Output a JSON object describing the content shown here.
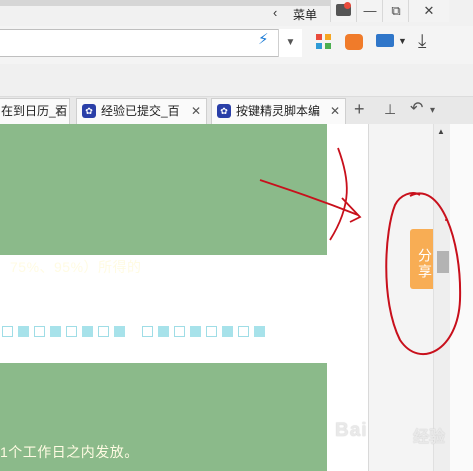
{
  "titlebar": {
    "back_glyph": "‹",
    "menu_label": "菜单",
    "minimize_glyph": "—",
    "restore_glyph": "⧉",
    "close_glyph": "✕"
  },
  "toolbar": {
    "address_value": "",
    "bolt_glyph": "⚡",
    "address_dropdown_glyph": "▼",
    "remote_dropdown_glyph": "▼",
    "download_glyph": "⤓"
  },
  "tabs": [
    {
      "label": "在到日历_百",
      "close": "✕"
    },
    {
      "label": "经验已提交_百",
      "close": "✕"
    },
    {
      "label": "按键精灵脚本编",
      "close": "✕"
    }
  ],
  "tabbar": {
    "new_tab_glyph": "+",
    "recent_glyph": "⊥",
    "undo_glyph": "↶",
    "undo_dropdown_glyph": "▾"
  },
  "page": {
    "text_line_1": "75%、95%）所得的",
    "text_line_2": "1个工作日之内发放。"
  },
  "sidebar": {
    "share_label": "分享"
  },
  "scrollbar": {
    "up_glyph": "▲"
  },
  "watermark": {
    "main": "Bai",
    "sub": "经验"
  },
  "colors": {
    "green_block": "#8bba8a",
    "share_button": "#f8ad54",
    "annotation_red": "#c8101c",
    "square_blue": "#a7e2ea"
  }
}
